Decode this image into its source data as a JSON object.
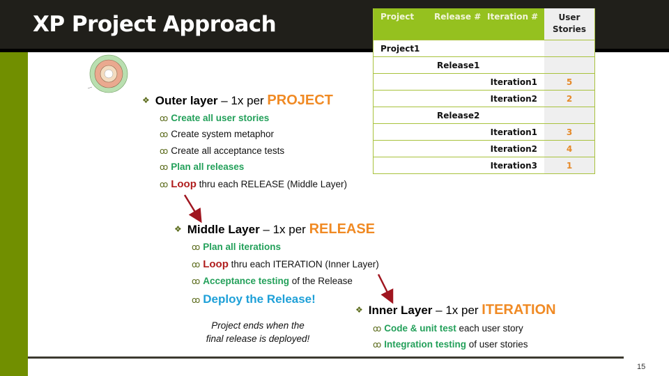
{
  "slide": {
    "title": "XP Project Approach",
    "page_number": "15"
  },
  "table": {
    "headers": [
      "Project",
      "Release #",
      "Iteration #",
      "User Stories"
    ],
    "rows": [
      {
        "project": "Project1",
        "release": "",
        "iteration": "",
        "stories": ""
      },
      {
        "project": "",
        "release": "Release1",
        "iteration": "",
        "stories": ""
      },
      {
        "project": "",
        "release": "",
        "iteration": "Iteration1",
        "stories": "5"
      },
      {
        "project": "",
        "release": "",
        "iteration": "Iteration2",
        "stories": "2"
      },
      {
        "project": "",
        "release": "Release2",
        "iteration": "",
        "stories": ""
      },
      {
        "project": "",
        "release": "",
        "iteration": "Iteration1",
        "stories": "3"
      },
      {
        "project": "",
        "release": "",
        "iteration": "Iteration2",
        "stories": "4"
      },
      {
        "project": "",
        "release": "",
        "iteration": "Iteration3",
        "stories": "1"
      }
    ]
  },
  "outer": {
    "heading": "Outer layer",
    "dash": " – 1x per ",
    "unit": "PROJECT",
    "items": {
      "i0": "Create all user stories",
      "i1": "Create system metaphor",
      "i2": "Create all acceptance tests",
      "i3": "Plan all releases",
      "i4_loop": "Loop",
      "i4_rest": " thru each RELEASE (Middle Layer)"
    }
  },
  "middle": {
    "heading": "Middle Layer",
    "dash": " – 1x per ",
    "unit": "RELEASE",
    "items": {
      "i0": "Plan all iterations",
      "i1_loop": "Loop",
      "i1_rest": " thru each ITERATION (Inner Layer)",
      "i2_green": "Acceptance testing",
      "i2_rest": " of the Release",
      "i3": "Deploy the Release!"
    },
    "note_line1": "Project ends when the",
    "note_line2": "final release is deployed!"
  },
  "inner": {
    "heading": "Inner Layer",
    "dash": " – 1x per ",
    "unit": "ITERATION",
    "items": {
      "i0_green": "Code & unit test",
      "i0_rest": " each user story",
      "i1_green": "Integration testing",
      "i1_rest": " of user stories"
    }
  },
  "icons": {
    "main_bullet": "❖",
    "sub_bullet": "ꝏ"
  },
  "colors": {
    "header_bg": "#201f1a",
    "accent_green": "#718f00",
    "table_header": "#95c11f",
    "orange": "#f08a24",
    "text_green": "#23a05a",
    "loop_red": "#b01e1e",
    "deploy_blue": "#1ea0d8"
  }
}
